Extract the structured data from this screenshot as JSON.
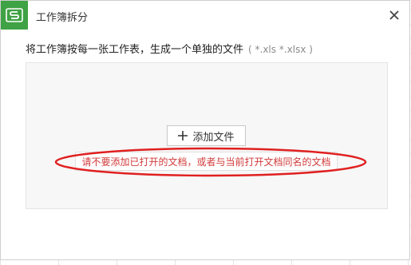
{
  "dialog": {
    "title": "工作簿拆分",
    "app_icon": "wps-spreadsheet-logo",
    "close_icon": "close-icon"
  },
  "instruction": {
    "text": "将工作簿按每一张工作表，生成一个单独的文件",
    "hint": "( *.xls *.xlsx )"
  },
  "drop_area": {
    "add_button_label": "添加文件",
    "add_icon": "plus-icon",
    "warning": "请不要添加已打开的文档，或者与当前打开文档同名的文档"
  },
  "colors": {
    "logo": "#3fa244",
    "warning_text": "#d23a3a",
    "annotation_ellipse": "#e02020"
  }
}
